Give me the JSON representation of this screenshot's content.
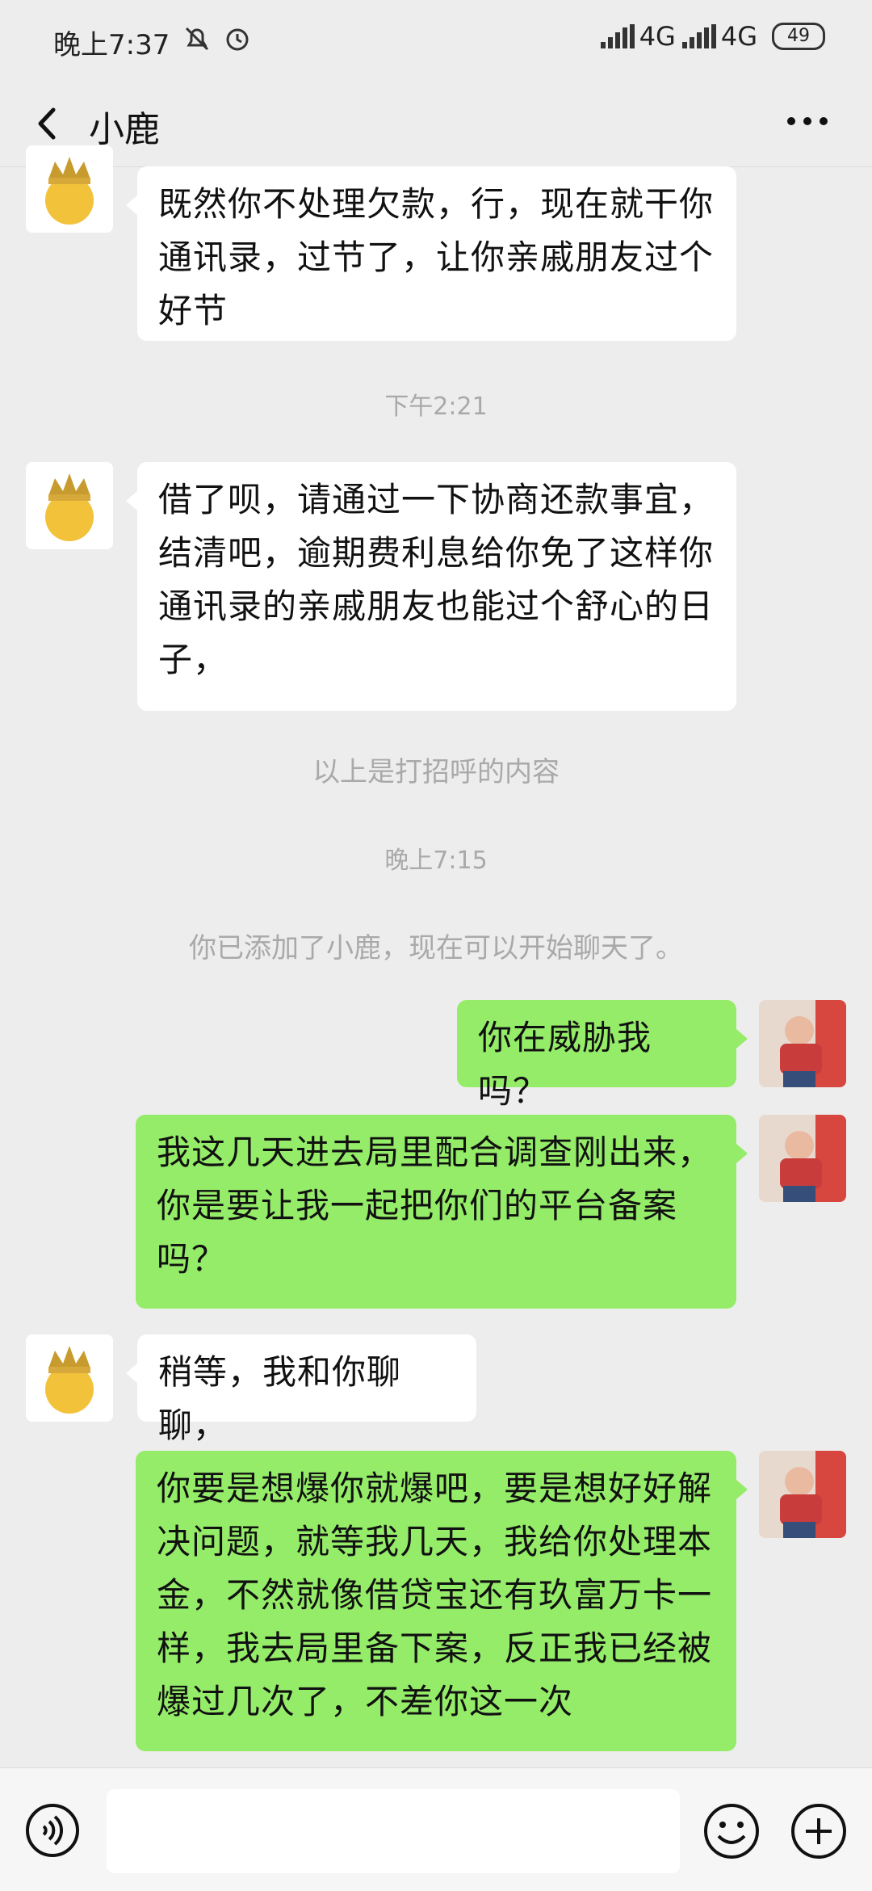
{
  "status_bar": {
    "time": "晚上7:37",
    "network1": "4G",
    "network2": "4G",
    "battery": "49"
  },
  "header": {
    "title": "小鹿"
  },
  "messages": [
    {
      "side": "left",
      "text": "既然你不处理欠款，行，现在就干你通讯录，过节了，让你亲戚朋友过个好节"
    },
    {
      "side": "system-time",
      "text": "下午2:21"
    },
    {
      "side": "left",
      "text": "借了呗，请通过一下协商还款事宜，结清吧，逾期费利息给你免了这样你通讯录的亲戚朋友也能过个舒心的日子，"
    },
    {
      "side": "system-note",
      "text": "以上是打招呼的内容"
    },
    {
      "side": "system-time",
      "text": "晚上7:15"
    },
    {
      "side": "system-note",
      "text": "你已添加了小鹿，现在可以开始聊天了。"
    },
    {
      "side": "right",
      "text": "你在威胁我吗？"
    },
    {
      "side": "right",
      "text": "我这几天进去局里配合调查刚出来，你是要让我一起把你们的平台备案吗？"
    },
    {
      "side": "left",
      "text": "稍等，我和你聊聊，"
    },
    {
      "side": "right",
      "text": "你要是想爆你就爆吧，要是想好好解决问题，就等我几天，我给你处理本金，不然就像借贷宝还有玖富万卡一样，我去局里备下案，反正我已经被爆过几次了，不差你这一次"
    }
  ],
  "colors": {
    "background": "#EDEDED",
    "bubble_self": "#95EC69",
    "bubble_other": "#FFFFFF",
    "system_text": "#A9A9A9"
  },
  "icons": {
    "back": "back-arrow-icon",
    "more": "more-dots-icon",
    "voice": "voice-icon",
    "emoji": "emoji-icon",
    "plus": "plus-icon"
  }
}
